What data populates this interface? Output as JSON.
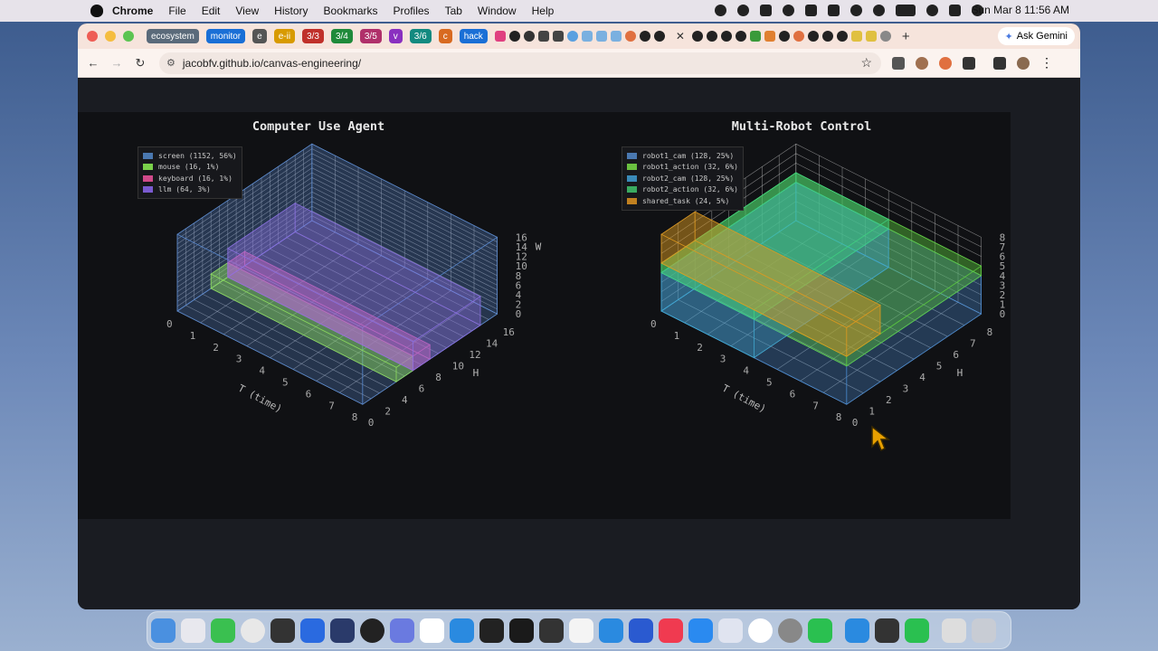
{
  "menubar": {
    "app": "Chrome",
    "items": [
      "File",
      "Edit",
      "View",
      "History",
      "Bookmarks",
      "Profiles",
      "Tab",
      "Window",
      "Help"
    ],
    "clock": "Sun Mar 8  11:56 AM"
  },
  "browser": {
    "tab_groups": [
      {
        "label": "ecosystem",
        "color": "#5a6a7a"
      },
      {
        "label": "monitor",
        "color": "#1a6fd6"
      },
      {
        "label": "e",
        "color": "#555555"
      },
      {
        "label": "e-ii",
        "color": "#d89a00"
      },
      {
        "label": "3/3",
        "color": "#c0302a"
      },
      {
        "label": "3/4",
        "color": "#1f8a3a"
      },
      {
        "label": "3/5",
        "color": "#b0306a"
      },
      {
        "label": "v",
        "color": "#8a30c0"
      },
      {
        "label": "3/6",
        "color": "#138a80"
      },
      {
        "label": "c",
        "color": "#d86a20"
      },
      {
        "label": "hack",
        "color": "#1a6fd6"
      }
    ],
    "ask_gemini": "Ask Gemini",
    "url": "jacobfv.github.io/canvas-engineering/"
  },
  "left_plot": {
    "title": "Computer Use Agent",
    "legend": [
      {
        "label": "screen (1152, 56%)",
        "color": "#4a78b0"
      },
      {
        "label": "mouse (16, 1%)",
        "color": "#7ad04a"
      },
      {
        "label": "keyboard (16, 1%)",
        "color": "#d04a8a"
      },
      {
        "label": "llm (64, 3%)",
        "color": "#7a5ad0"
      }
    ],
    "t_label": "T (time)",
    "h_label": "H",
    "w_label": "W",
    "t_ticks": [
      "0",
      "1",
      "2",
      "3",
      "4",
      "5",
      "6",
      "7",
      "8"
    ],
    "h_ticks": [
      "0",
      "2",
      "4",
      "6",
      "8",
      "10",
      "12",
      "14",
      "16"
    ],
    "w_ticks": [
      "0",
      "2",
      "4",
      "6",
      "8",
      "10",
      "12",
      "14",
      "16"
    ]
  },
  "right_plot": {
    "title": "Multi-Robot Control",
    "legend": [
      {
        "label": "robot1_cam (128, 25%)",
        "color": "#4a78b0"
      },
      {
        "label": "robot1_action (32, 6%)",
        "color": "#6ac040"
      },
      {
        "label": "robot2_cam (128, 25%)",
        "color": "#3a8ab8"
      },
      {
        "label": "robot2_action (32, 6%)",
        "color": "#3aaa60"
      },
      {
        "label": "shared_task (24, 5%)",
        "color": "#c08020"
      }
    ],
    "t_label": "T (time)",
    "h_label": "H",
    "w_label": "",
    "t_ticks": [
      "0",
      "1",
      "2",
      "3",
      "4",
      "5",
      "6",
      "7",
      "8"
    ],
    "h_ticks": [
      "0",
      "1",
      "2",
      "3",
      "4",
      "5",
      "6",
      "7",
      "8"
    ],
    "w_ticks": [
      "0",
      "1",
      "2",
      "3",
      "4",
      "5",
      "6",
      "7",
      "8"
    ]
  }
}
